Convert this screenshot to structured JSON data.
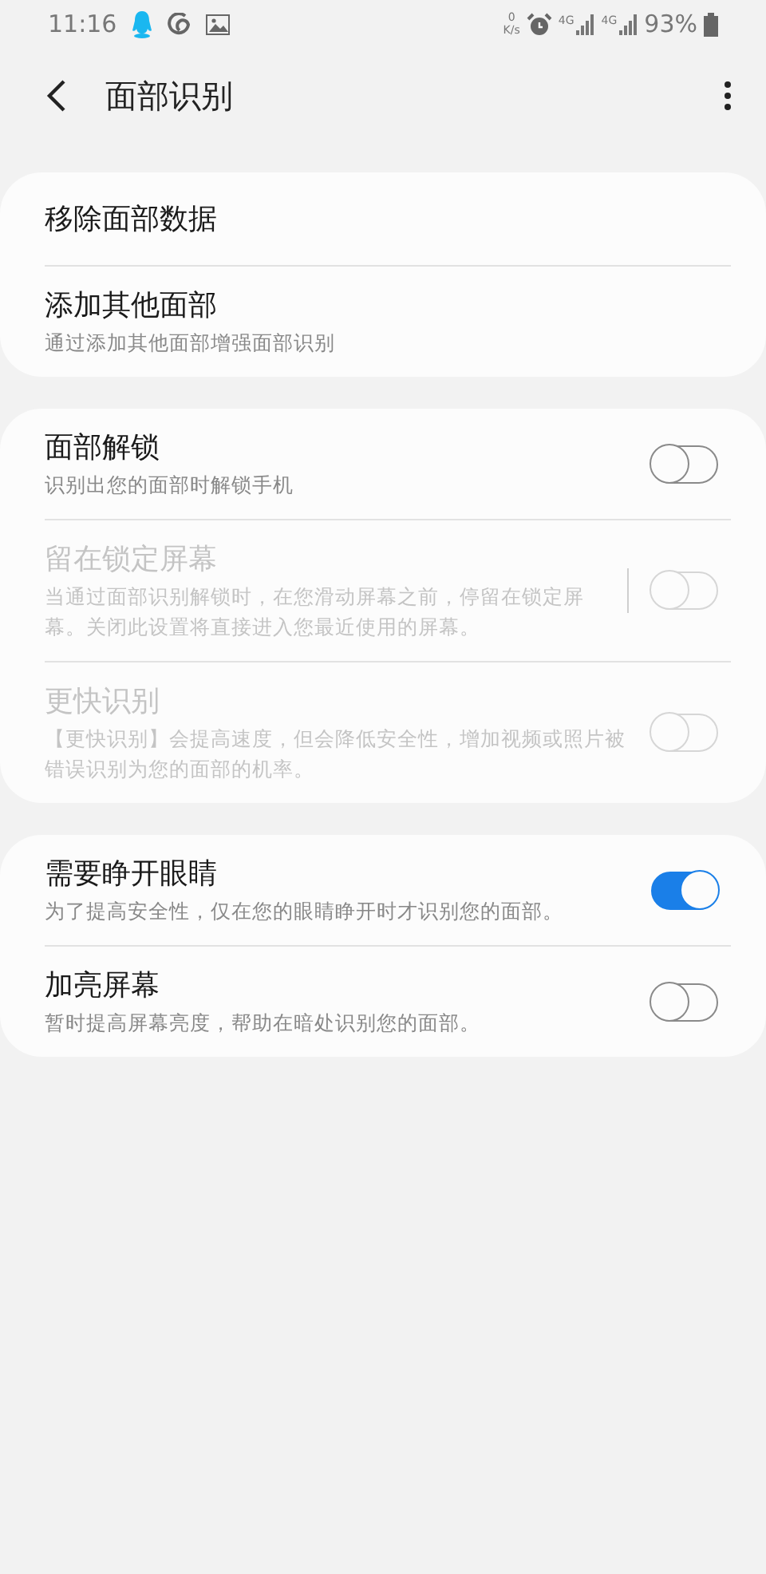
{
  "status_bar": {
    "time": "11:16",
    "speed_value": "0",
    "speed_unit": "K/s",
    "network_labels": [
      "4G",
      "4G"
    ],
    "battery": "93%"
  },
  "header": {
    "title": "面部识别"
  },
  "groups": [
    {
      "items": [
        {
          "kind": "link",
          "title": "移除面部数据",
          "disabled": false
        },
        {
          "kind": "link",
          "title": "添加其他面部",
          "subtitle": "通过添加其他面部增强面部识别",
          "disabled": false
        }
      ]
    },
    {
      "items": [
        {
          "kind": "switch",
          "title": "面部解锁",
          "subtitle": "识别出您的面部时解锁手机",
          "disabled": false,
          "on": false,
          "separator": false
        },
        {
          "kind": "switch",
          "title": "留在锁定屏幕",
          "subtitle": "当通过面部识别解锁时，在您滑动屏幕之前，停留在锁定屏幕。关闭此设置将直接进入您最近使用的屏幕。",
          "disabled": true,
          "on": false,
          "separator": true
        },
        {
          "kind": "switch",
          "title": "更快识别",
          "subtitle": "【更快识别】会提高速度，但会降低安全性，增加视频或照片被错误识别为您的面部的机率。",
          "disabled": true,
          "on": false,
          "separator": false
        }
      ]
    },
    {
      "items": [
        {
          "kind": "switch",
          "title": "需要睁开眼睛",
          "subtitle": "为了提高安全性，仅在您的眼睛睁开时才识别您的面部。",
          "disabled": false,
          "on": true,
          "separator": false
        },
        {
          "kind": "switch",
          "title": "加亮屏幕",
          "subtitle": "暂时提高屏幕亮度，帮助在暗处识别您的面部。",
          "disabled": false,
          "on": false,
          "separator": false
        }
      ]
    }
  ]
}
